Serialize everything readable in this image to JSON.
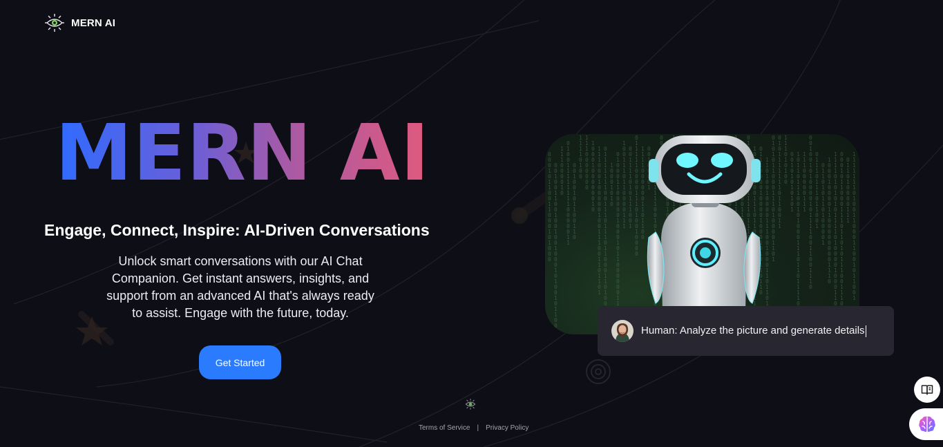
{
  "header": {
    "brand": "MERN AI",
    "logo_icon": "eye-circuit-icon"
  },
  "hero": {
    "title": "MERN AI",
    "tagline": "Engage, Connect, Inspire: AI-Driven Conversations",
    "description": "Unlock smart conversations with our AI Chat Companion. Get instant answers, insights, and support from an advanced AI that's always ready to assist. Engage with the future, today.",
    "cta_label": "Get Started",
    "gradient_colors": [
      "#2f6bff",
      "#6a5fd8",
      "#a85aa6",
      "#e55a7a"
    ]
  },
  "showcase": {
    "robot_image": "robot-illustration",
    "prompt_text": "Human: Analyze the picture and generate details"
  },
  "footer": {
    "terms": "Terms of Service",
    "separator": "|",
    "privacy": "Privacy Policy",
    "icon": "eye-circuit-icon"
  },
  "floating": {
    "book_icon": "book-icon",
    "brain_icon": "brain-icon"
  },
  "colors": {
    "background": "#0e0e17",
    "accent": "#2b7bff",
    "bubble": "#282631"
  }
}
